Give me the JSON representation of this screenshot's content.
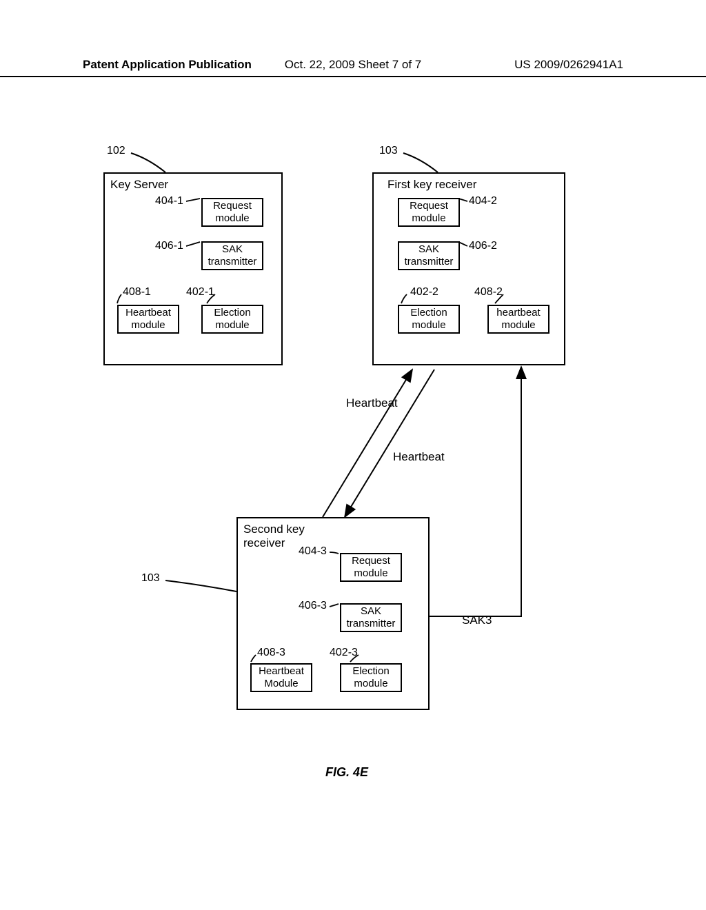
{
  "header": {
    "left": "Patent Application Publication",
    "mid": "Oct. 22, 2009   Sheet 7 of 7",
    "right": "US 2009/0262941A1"
  },
  "figure_label": "FIG. 4E",
  "boxes": {
    "key_server": {
      "title": "Key Server",
      "ref": "102",
      "modules": {
        "request": {
          "label": "Request\nmodule",
          "ref": "404-1"
        },
        "sak": {
          "label": "SAK\ntransmitter",
          "ref": "406-1"
        },
        "heartbeat": {
          "label": "Heartbeat\nmodule",
          "ref": "408-1"
        },
        "election": {
          "label": "Election\nmodule",
          "ref": "402-1"
        }
      }
    },
    "first_receiver": {
      "title": "First key receiver",
      "ref": "103",
      "modules": {
        "request": {
          "label": "Request\nmodule",
          "ref": "404-2"
        },
        "sak": {
          "label": "SAK\ntransmitter",
          "ref": "406-2"
        },
        "election": {
          "label": "Election\nmodule",
          "ref": "402-2"
        },
        "heartbeat": {
          "label": "heartbeat\nmodule",
          "ref": "408-2"
        }
      }
    },
    "second_receiver": {
      "title": "Second key\nreceiver",
      "ref": "103",
      "modules": {
        "request": {
          "label": "Request\nmodule",
          "ref": "404-3"
        },
        "sak": {
          "label": "SAK\ntransmitter",
          "ref": "406-3"
        },
        "heartbeat": {
          "label": "Heartbeat\nModule",
          "ref": "408-3"
        },
        "election": {
          "label": "Election\nmodule",
          "ref": "402-3"
        }
      }
    }
  },
  "arrows": {
    "heartbeat1": "Heartbeat",
    "heartbeat2": "Heartbeat",
    "sak3": "SAK3"
  }
}
